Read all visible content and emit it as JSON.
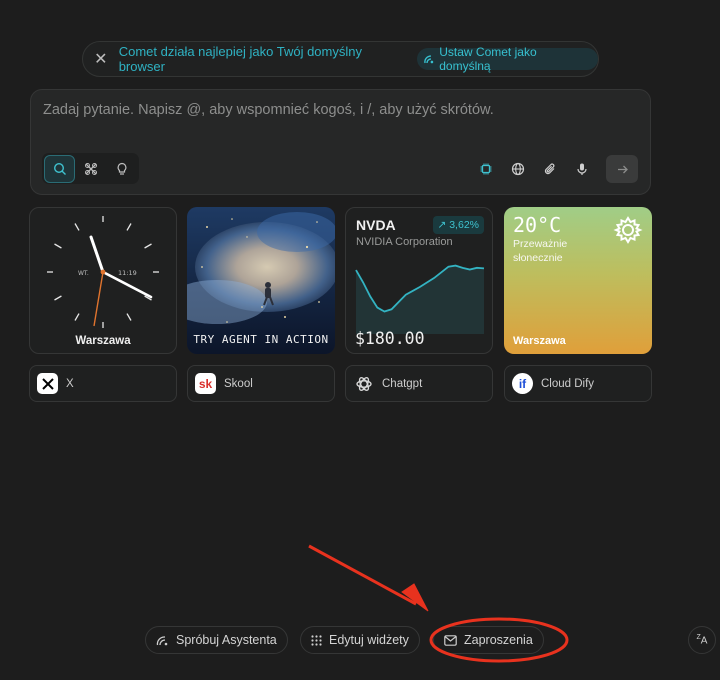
{
  "banner": {
    "message": "Comet działa najlepiej jako Twój domyślny browser",
    "set_default_label": "Ustaw Comet jako domyślną",
    "accent": "#2fb2c3"
  },
  "ask": {
    "placeholder": "Zadaj pytanie. Napisz @, aby wspomnieć kogoś, i /, aby użyć skrótów.",
    "modes": [
      "search-icon",
      "apps-icon",
      "lightbulb-icon"
    ],
    "active_mode": "search-icon",
    "tools": [
      "chip-icon",
      "globe-icon",
      "paperclip-icon",
      "mic-icon"
    ]
  },
  "widgets": {
    "clock": {
      "day": "WT.",
      "time": "11:19",
      "city": "Warszawa"
    },
    "agent": {
      "label": "TRY AGENT IN ACTION"
    },
    "stock": {
      "ticker": "NVDA",
      "company": "NVIDIA Corporation",
      "change": "3,62%",
      "price": "$180.00",
      "trend": [
        0.82,
        0.6,
        0.35,
        0.15,
        0.08,
        0.12,
        0.25,
        0.38,
        0.45,
        0.52,
        0.6,
        0.68,
        0.78,
        0.88,
        0.9,
        0.86,
        0.83,
        0.86,
        0.85
      ],
      "color": "#33b3c2"
    },
    "weather": {
      "temp": "20°C",
      "condition": "Przeważnie słonecznie",
      "city": "Warszawa"
    }
  },
  "shortcuts": [
    {
      "label": "X",
      "icon": "x-logo-icon"
    },
    {
      "label": "Skool",
      "icon": "skool-logo-icon"
    },
    {
      "label": "Chatgpt",
      "icon": "chatgpt-logo-icon"
    },
    {
      "label": "Cloud Dify",
      "icon": "dify-logo-icon"
    }
  ],
  "skool_icon_text": "sk",
  "dify_icon_text": "if",
  "footer": {
    "assistant_label": "Spróbuj Asystenta",
    "edit_widgets_label": "Edytuj widżety",
    "invites_label": "Zaproszenia",
    "language_icon_text": "A"
  },
  "annotation_color": "#e8321e"
}
